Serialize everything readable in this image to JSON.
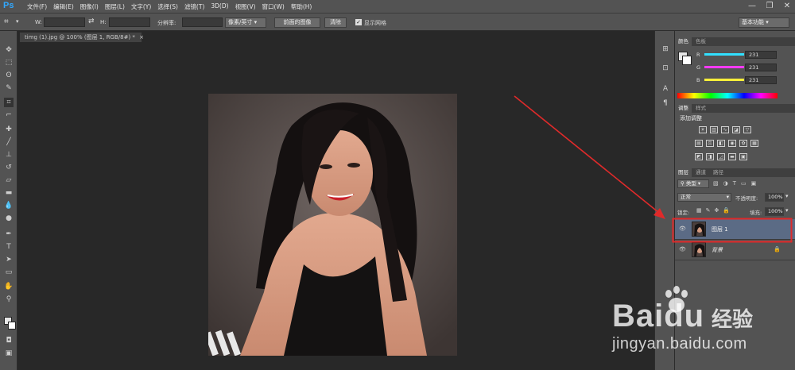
{
  "app": {
    "logo": "Ps"
  },
  "menu": [
    "文件(F)",
    "编辑(E)",
    "图像(I)",
    "图层(L)",
    "文字(Y)",
    "选择(S)",
    "滤镜(T)",
    "3D(D)",
    "视图(V)",
    "窗口(W)",
    "帮助(H)"
  ],
  "window_controls": {
    "minimize": "—",
    "restore": "❐",
    "close": "✕"
  },
  "options_bar": {
    "width_label": "W:",
    "height_label": "H:",
    "resolution_label": "分辨率:",
    "unit_select": "像素/英寸",
    "front_image_button": "前面的图像",
    "clear_button": "清除",
    "show_grid_label": "显示网格",
    "workspace_select": "基本功能"
  },
  "document": {
    "tab_title": "timg (1).jpg @ 100% (图层 1, RGB/8#) *",
    "tab_close": "×"
  },
  "color_panel": {
    "tabs": [
      "颜色",
      "色板"
    ],
    "channels": [
      {
        "label": "R",
        "value": "231",
        "gradient": "#31e0ff"
      },
      {
        "label": "G",
        "value": "231",
        "gradient": "#ff3aff"
      },
      {
        "label": "B",
        "value": "231",
        "gradient": "#fff03a"
      }
    ]
  },
  "adjustments_panel": {
    "tabs": [
      "调整",
      "样式"
    ],
    "title": "添加调整"
  },
  "layers_panel": {
    "tabs": [
      "图层",
      "通道",
      "路径"
    ],
    "filter_select": "类型",
    "blend_mode": "正常",
    "opacity_label": "不透明度:",
    "opacity_value": "100%",
    "lock_label": "锁定:",
    "fill_label": "填充:",
    "fill_value": "100%",
    "layers": [
      {
        "name": "图层 1",
        "selected": true
      },
      {
        "name": "背景",
        "selected": false,
        "locked": true
      }
    ]
  },
  "annotation": {
    "color": "#e02a2a"
  },
  "watermark": {
    "brand": "Baidu",
    "jingyan": "经验",
    "url": "jingyan.baidu.com"
  }
}
